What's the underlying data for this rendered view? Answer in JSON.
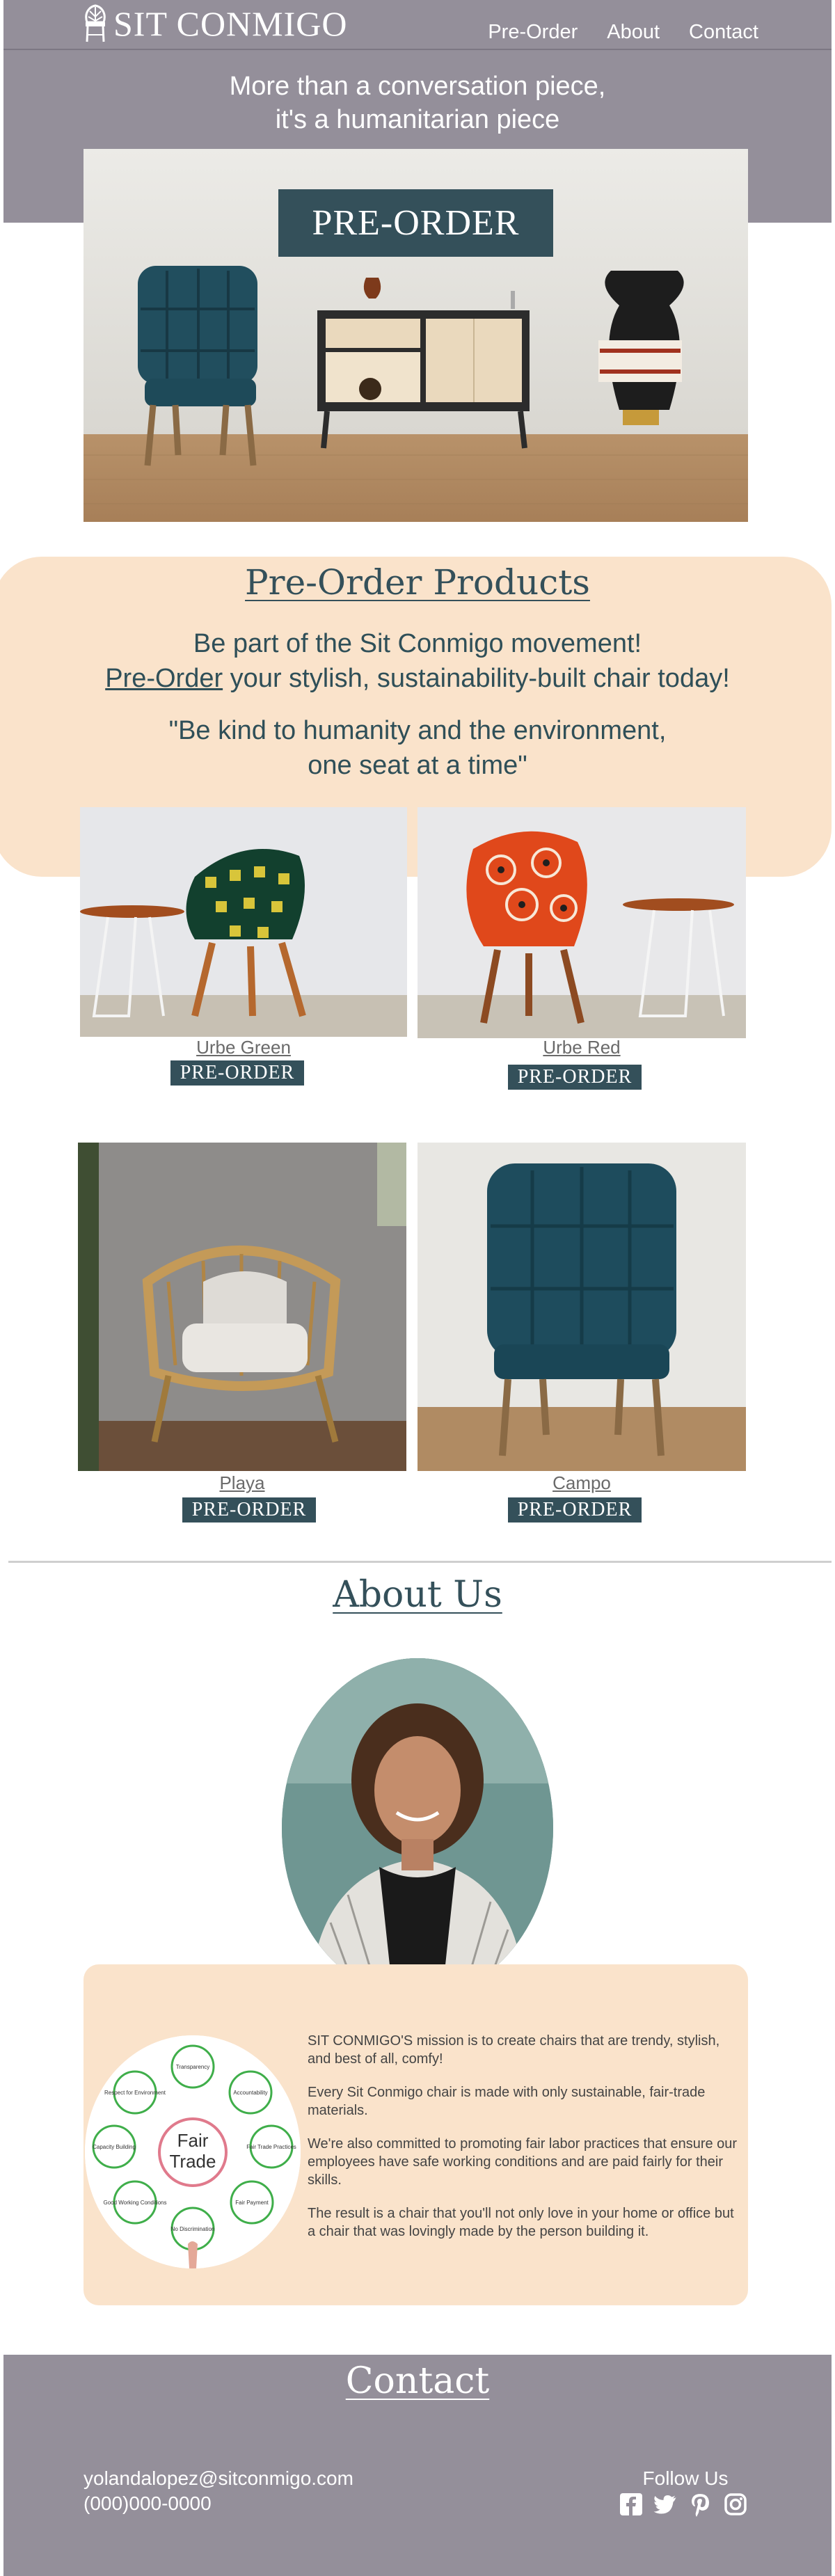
{
  "header": {
    "logo_text": "SIT CONMIGO",
    "nav": [
      "Pre-Order",
      "About",
      "Contact"
    ],
    "tagline_line1": "More than a conversation piece,",
    "tagline_line2": "it's a humanitarian piece",
    "hero_button": "PRE-ORDER"
  },
  "products": {
    "title": "Pre-Order Products",
    "sub_line1": "Be part of the Sit Conmigo movement!",
    "sub_link": "Pre-Order",
    "sub_line2_rest": " your stylish, sustainability-built chair today!",
    "quote_line1": "\"Be kind to humanity and the environment,",
    "quote_line2": "one seat at a time\"",
    "items": [
      {
        "name": "Urbe Green",
        "button": "PRE-ORDER"
      },
      {
        "name": "Urbe Red",
        "button": "PRE-ORDER"
      },
      {
        "name": "Playa",
        "button": "PRE-ORDER"
      },
      {
        "name": "Campo",
        "button": "PRE-ORDER"
      }
    ]
  },
  "about": {
    "title": "About Us",
    "fair_trade_center": [
      "Fair",
      "Trade"
    ],
    "fair_trade_labels": [
      "Transparency",
      "Accountability",
      "Fair Trade Practices",
      "Fair Payment",
      "No Discrimination",
      "Good Working Conditions",
      "Capacity Building",
      "Respect for Environment"
    ],
    "paragraphs": [
      "SIT CONMIGO'S mission is to create chairs that are trendy,  stylish, and best of all, comfy!",
      "Every Sit Conmigo chair is made with only sustainable, fair-trade materials.",
      "We're also committed to promoting fair labor practices that ensure our employees have safe working conditions and are paid fairly for their skills.",
      "The result is a chair that you'll not only love in your home or office but a chair that was lovingly made by the person building it."
    ]
  },
  "contact": {
    "title": "Contact",
    "email": "yolandalopez@sitconmigo.com",
    "phone": "(000)000-0000",
    "follow_label": "Follow Us",
    "social_icons": [
      "facebook-icon",
      "twitter-icon",
      "pinterest-icon",
      "instagram-icon"
    ]
  },
  "colors": {
    "header_bg": "#948f9a",
    "accent_teal": "#34505a",
    "band_peach": "#fae3cb"
  }
}
